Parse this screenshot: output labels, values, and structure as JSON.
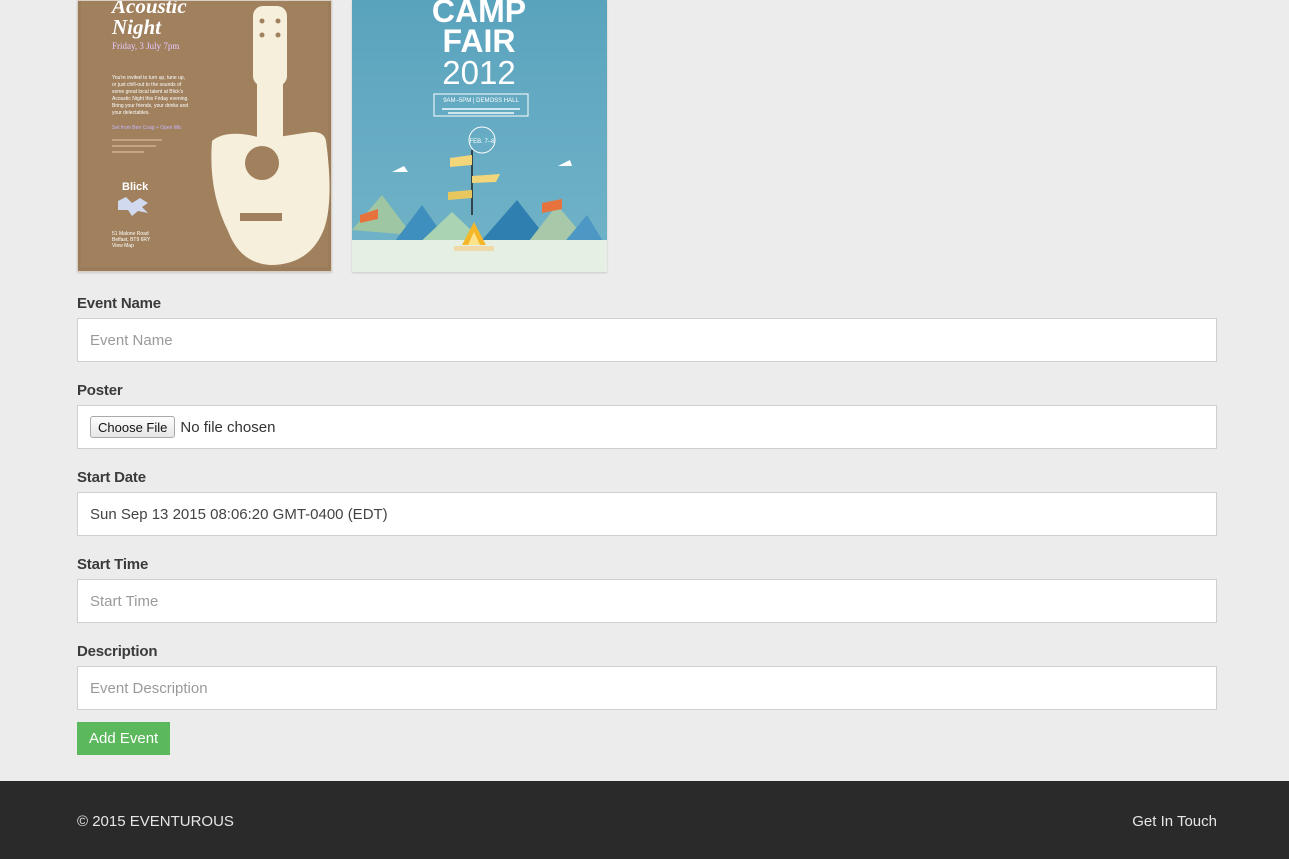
{
  "posters": [
    {
      "title_line1": "Acoustic",
      "title_line2": "Night",
      "date": "Friday, 3 July 7pm",
      "body": [
        "You're invited to turn up, tune up,",
        "or just chill-out to the sounds of",
        "some great local talent at Blick's",
        "Acoustic Night this Friday evening.",
        "Bring your friends, your drinks and",
        "your delectables."
      ],
      "highlight": "Set from Ben Craig + Open Mic",
      "brand": "Blick",
      "address": [
        "51 Malone Road",
        "Belfast, BT9 6RY",
        "View Map"
      ]
    },
    {
      "title_line1": "CAMP",
      "title_line2": "FAIR",
      "year": "2012",
      "details": "9AM–5PM | DEMOSS HALL",
      "dates": "FEB. 7–8"
    }
  ],
  "form": {
    "event_name": {
      "label": "Event Name",
      "placeholder": "Event Name",
      "value": ""
    },
    "poster": {
      "label": "Poster",
      "button_label": "Choose File",
      "status": "No file chosen"
    },
    "start_date": {
      "label": "Start Date",
      "value": "Sun Sep 13 2015 08:06:20 GMT-0400 (EDT)"
    },
    "start_time": {
      "label": "Start Time",
      "placeholder": "Start Time",
      "value": ""
    },
    "description": {
      "label": "Description",
      "placeholder": "Event Description",
      "value": ""
    },
    "submit_label": "Add Event"
  },
  "footer": {
    "copyright": "© 2015 EVENTUROUS",
    "contact_link": "Get In Touch"
  },
  "colors": {
    "page_background": "#ececec",
    "footer_background": "#2a2a2a",
    "submit_button": "#5cb85c",
    "poster1_background": "#9a7b5a",
    "poster2_background": "#5ea6be"
  }
}
